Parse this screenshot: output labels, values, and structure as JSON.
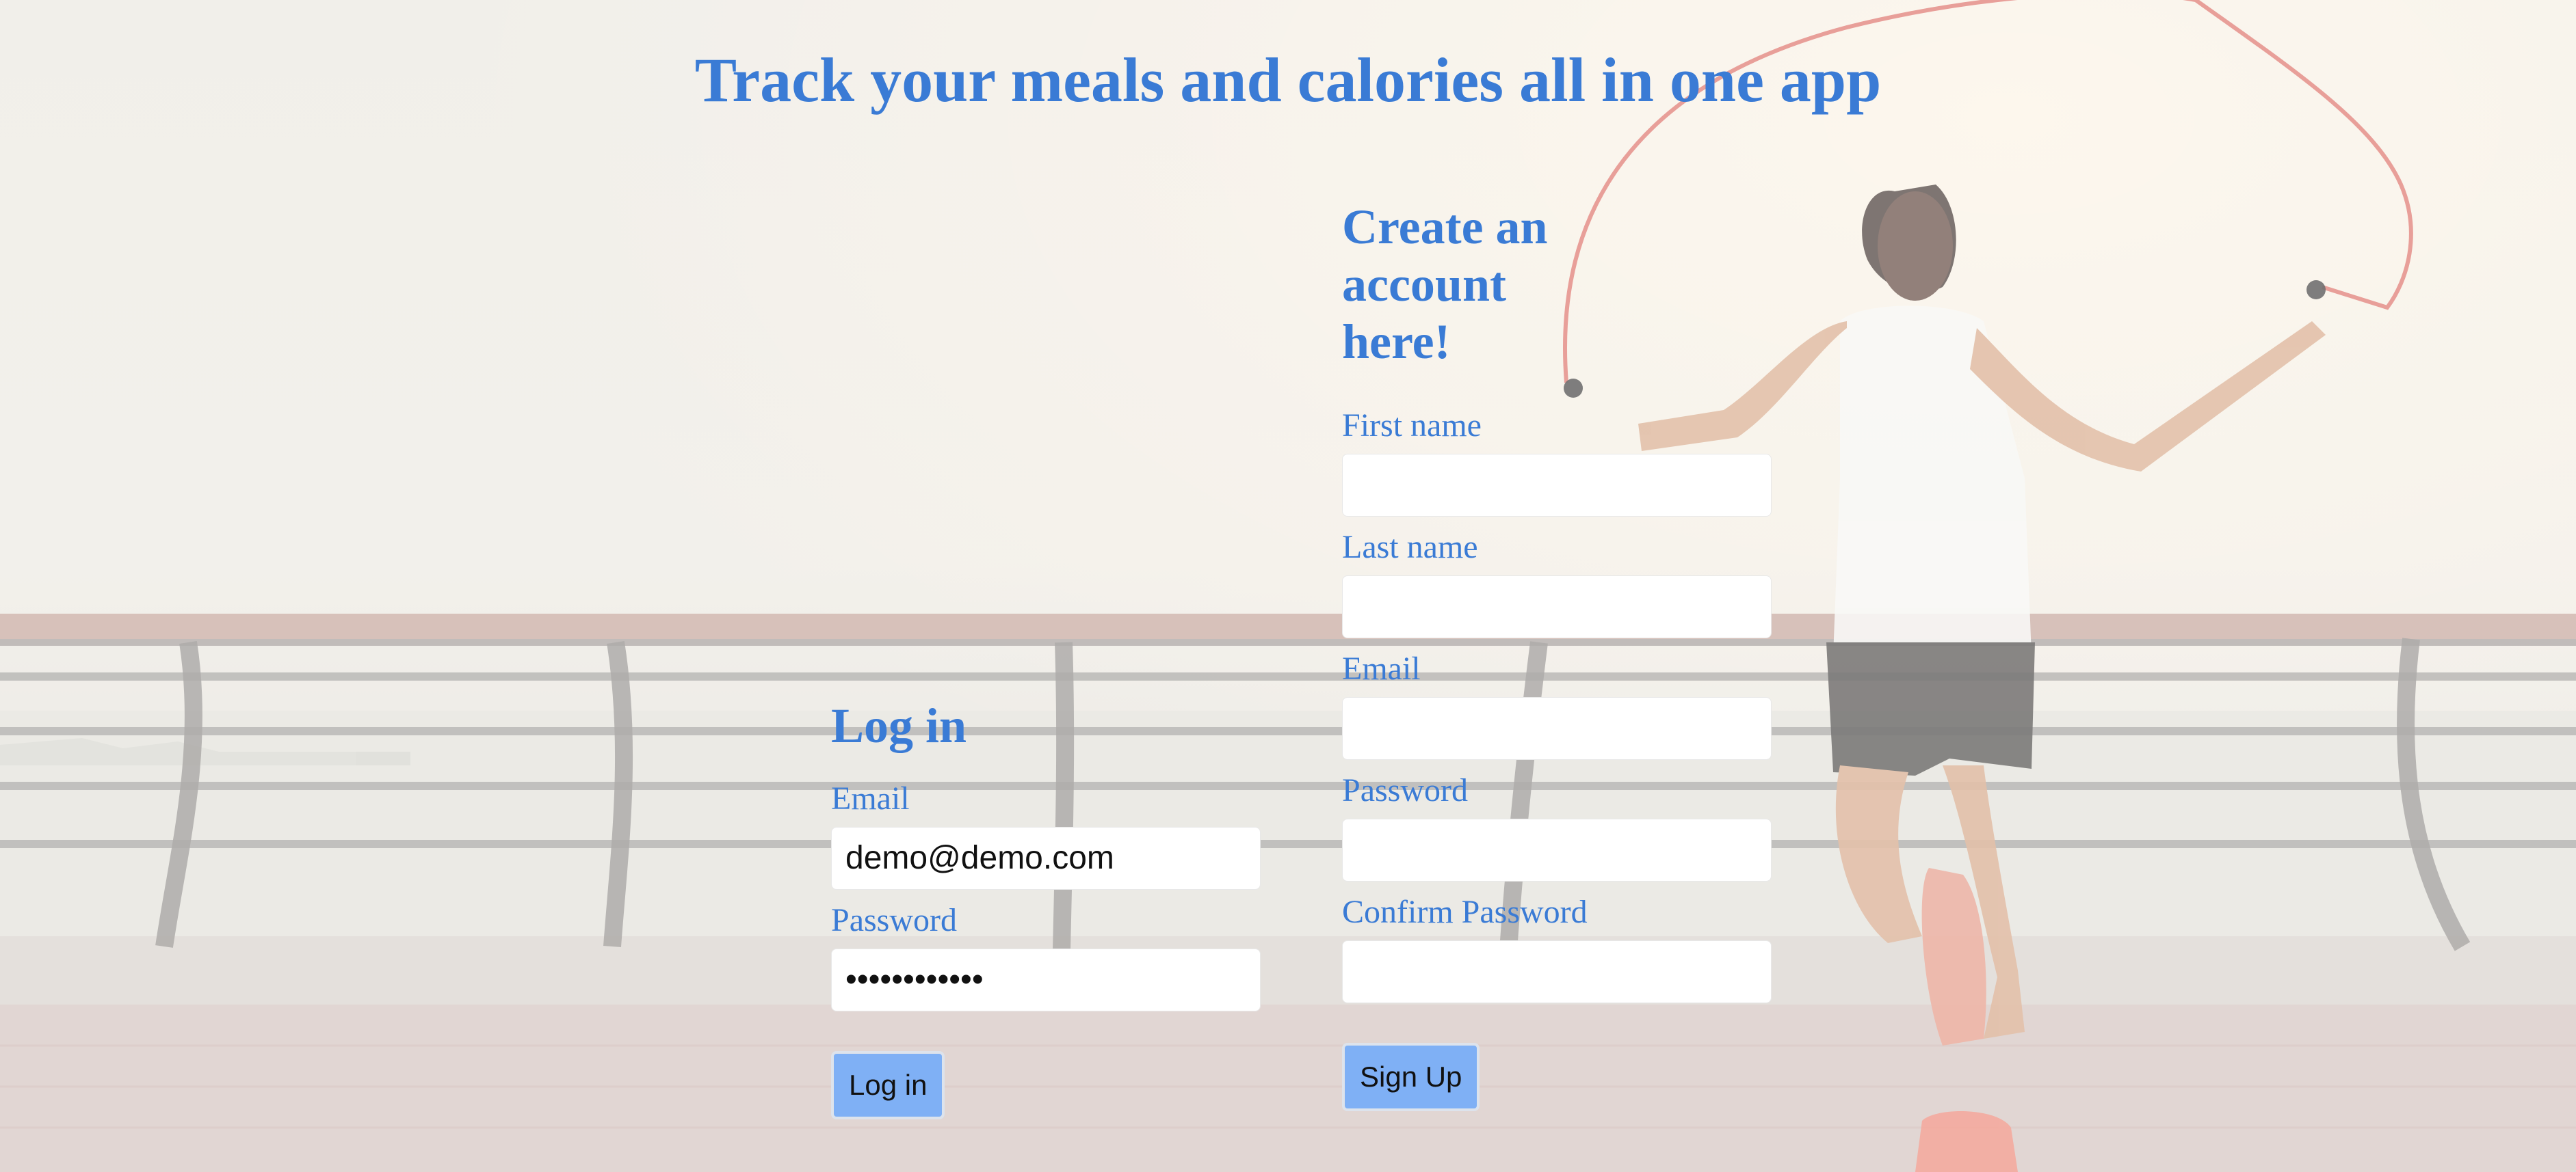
{
  "page": {
    "title": "Track your meals and calories all in one app"
  },
  "login": {
    "heading": "Log in",
    "email_label": "Email",
    "email_value": "demo@demo.com",
    "password_label": "Password",
    "password_value": "••••••••••••",
    "button_label": "Log in"
  },
  "signup": {
    "heading": "Create an account here!",
    "first_name_label": "First name",
    "last_name_label": "Last name",
    "email_label": "Email",
    "password_label": "Password",
    "confirm_password_label": "Confirm Password",
    "button_label": "Sign Up"
  },
  "colors": {
    "accent": "#3a7bd5",
    "button": "#7fb0f5"
  }
}
